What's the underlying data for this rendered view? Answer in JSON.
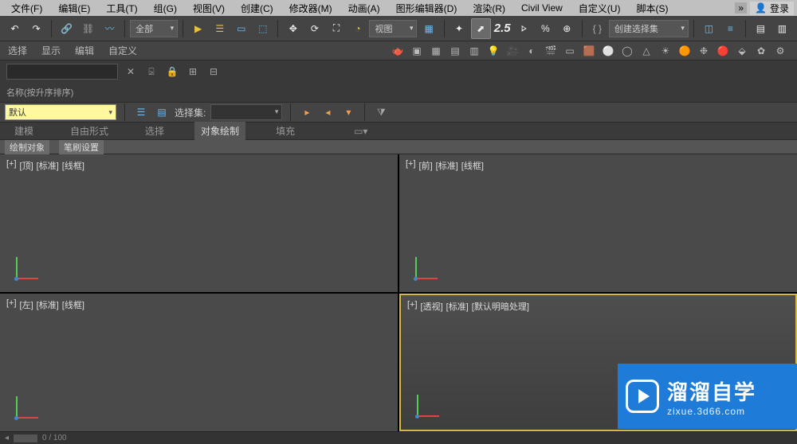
{
  "menu": {
    "items": [
      "文件(F)",
      "编辑(E)",
      "工具(T)",
      "组(G)",
      "视图(V)",
      "创建(C)",
      "修改器(M)",
      "动画(A)",
      "图形编辑器(D)",
      "渲染(R)",
      "Civil View",
      "自定义(U)",
      "脚本(S)"
    ],
    "login": "登录"
  },
  "tb1": {
    "filter": "全部",
    "view": "视图",
    "create_sel": "创建选择集",
    "label25": "2.5"
  },
  "subtabs": {
    "items": [
      "选择",
      "显示",
      "编辑",
      "自定义"
    ]
  },
  "name_label": "名称(按升序排序)",
  "default_combo": "默认",
  "sel_label": "选择集:",
  "ribbon": {
    "tabs": [
      "建模",
      "自由形式",
      "选择",
      "对象绘制",
      "填充"
    ],
    "active_index": 3,
    "sub": [
      "绘制对象",
      "笔刷设置"
    ]
  },
  "viewports": [
    {
      "label": [
        "[+]",
        "[顶]",
        "[标准]",
        "[线框]"
      ]
    },
    {
      "label": [
        "[+]",
        "[前]",
        "[标准]",
        "[线框]"
      ]
    },
    {
      "label": [
        "[+]",
        "[左]",
        "[标准]",
        "[线框]"
      ]
    },
    {
      "label": [
        "[+]",
        "[透视]",
        "[标准]",
        "[默认明暗处理]"
      ],
      "active": true,
      "obj": "◗◗"
    }
  ],
  "bottom": {
    "pos": "0 / 100"
  },
  "watermark": {
    "big": "溜溜自学",
    "small": "zixue.3d66.com"
  }
}
